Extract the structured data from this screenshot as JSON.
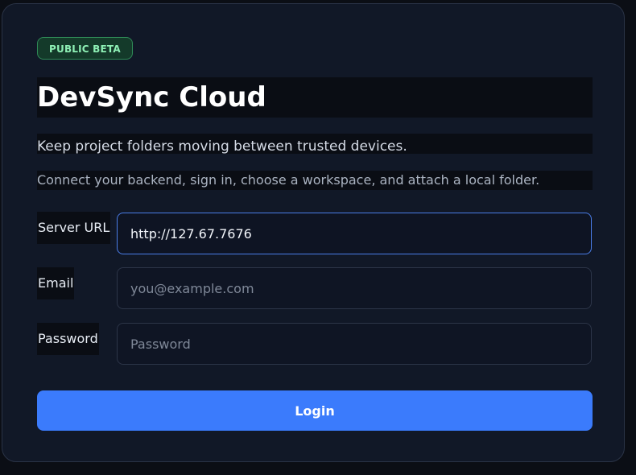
{
  "badge": "PUBLIC BETA",
  "title": "DevSync Cloud",
  "subtitle": "Keep project folders moving between trusted devices.",
  "description": "Connect your backend, sign in, choose a workspace, and attach a local folder.",
  "form": {
    "server_url": {
      "label": "Server URL",
      "value": "http://127.67.7676"
    },
    "email": {
      "label": "Email",
      "value": "",
      "placeholder": "you@example.com"
    },
    "password": {
      "label": "Password",
      "value": "",
      "placeholder": "Password"
    }
  },
  "login_button": "Login",
  "colors": {
    "accent": "#3b7bfc",
    "badge_text": "#8ef0b5",
    "badge_bg": "#143a2a",
    "card_bg": "#111827"
  }
}
